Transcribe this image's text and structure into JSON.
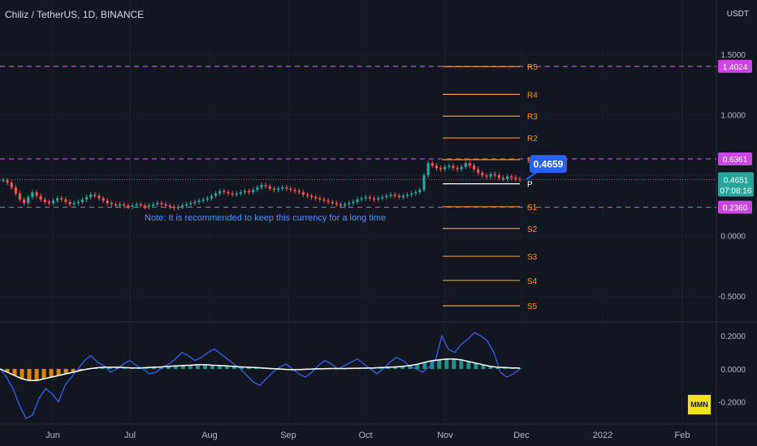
{
  "header": {
    "title": "Chiliz / TetherUS, 1D, BINANCE",
    "currency": "USDT"
  },
  "badge": "MMN",
  "colors": {
    "background": "#131722",
    "up": "#26a69a",
    "down": "#ef5350",
    "pivot": "#f7931a",
    "level": "#c946e0",
    "note": "#4f8ff7",
    "callout": "#2962ff",
    "oscillator": "#3465ff",
    "signal": "#ffffff"
  },
  "chart_data": [
    {
      "type": "candlestick",
      "title": "Chiliz / TetherUS, 1D, BINANCE",
      "x_ticks": [
        "Jun",
        "Jul",
        "Aug",
        "Sep",
        "Oct",
        "Nov",
        "Dec",
        "2022",
        "Feb"
      ],
      "y_ticks": [
        "1.5000",
        "1.0000",
        "0.5000",
        "0.0000",
        "-0.5000"
      ],
      "y_tick_values": [
        1.5,
        1.0,
        0.5,
        0.0,
        -0.5
      ],
      "ylim": [
        -0.7,
        1.75
      ],
      "last_price": "0.4651",
      "countdown": "07:08:16",
      "horizontal_levels": [
        {
          "value": 1.4024,
          "label": "1.4024"
        },
        {
          "value": 0.6361,
          "label": "0.6361"
        },
        {
          "value": 0.236,
          "label": "0.2360"
        }
      ],
      "pivots": [
        {
          "name": "R5",
          "value": 1.4
        },
        {
          "name": "R4",
          "value": 1.17
        },
        {
          "name": "R3",
          "value": 0.99
        },
        {
          "name": "R2",
          "value": 0.81
        },
        {
          "name": "R1",
          "value": 0.63
        },
        {
          "name": "P",
          "value": 0.43
        },
        {
          "name": "S1",
          "value": 0.24
        },
        {
          "name": "S2",
          "value": 0.06
        },
        {
          "name": "S3",
          "value": -0.17
        },
        {
          "name": "S4",
          "value": -0.37
        },
        {
          "name": "S5",
          "value": -0.58
        }
      ],
      "callout": {
        "label": "0.4659",
        "value": 0.4659
      },
      "annotation": "Note: It is recommended to keep this currency for a long time",
      "closes": [
        0.46,
        0.44,
        0.4,
        0.35,
        0.3,
        0.27,
        0.32,
        0.36,
        0.33,
        0.3,
        0.28,
        0.27,
        0.29,
        0.31,
        0.3,
        0.28,
        0.26,
        0.27,
        0.28,
        0.3,
        0.32,
        0.34,
        0.33,
        0.31,
        0.29,
        0.27,
        0.26,
        0.25,
        0.26,
        0.25,
        0.24,
        0.25,
        0.26,
        0.25,
        0.24,
        0.25,
        0.26,
        0.27,
        0.26,
        0.25,
        0.24,
        0.23,
        0.24,
        0.25,
        0.26,
        0.27,
        0.28,
        0.29,
        0.3,
        0.31,
        0.33,
        0.35,
        0.37,
        0.36,
        0.35,
        0.34,
        0.35,
        0.36,
        0.37,
        0.36,
        0.38,
        0.4,
        0.42,
        0.41,
        0.39,
        0.38,
        0.39,
        0.4,
        0.39,
        0.38,
        0.37,
        0.36,
        0.34,
        0.33,
        0.32,
        0.31,
        0.3,
        0.29,
        0.28,
        0.27,
        0.26,
        0.25,
        0.26,
        0.27,
        0.28,
        0.3,
        0.31,
        0.32,
        0.31,
        0.3,
        0.31,
        0.32,
        0.33,
        0.34,
        0.33,
        0.32,
        0.33,
        0.34,
        0.35,
        0.36,
        0.38,
        0.5,
        0.6,
        0.58,
        0.56,
        0.55,
        0.57,
        0.58,
        0.56,
        0.55,
        0.57,
        0.6,
        0.58,
        0.55,
        0.52,
        0.5,
        0.49,
        0.51,
        0.5,
        0.48,
        0.47,
        0.49,
        0.48,
        0.47,
        0.4651
      ]
    },
    {
      "type": "oscillator",
      "y_ticks": [
        "0.2000",
        "0.0000",
        "-0.2000"
      ],
      "y_tick_values": [
        0.2,
        0.0,
        -0.2
      ],
      "ylim": [
        -0.32,
        0.27
      ],
      "line": [
        0.0,
        -0.05,
        -0.12,
        -0.22,
        -0.3,
        -0.28,
        -0.18,
        -0.12,
        -0.15,
        -0.2,
        -0.1,
        -0.05,
        0.0,
        0.05,
        0.08,
        0.04,
        0.02,
        -0.02,
        0.0,
        0.03,
        0.05,
        0.02,
        0.0,
        -0.03,
        -0.02,
        0.01,
        0.03,
        0.06,
        0.1,
        0.08,
        0.05,
        0.07,
        0.1,
        0.12,
        0.09,
        0.06,
        0.03,
        0.0,
        -0.04,
        -0.08,
        -0.1,
        -0.06,
        -0.02,
        0.01,
        0.03,
        0.0,
        -0.03,
        -0.05,
        -0.02,
        0.02,
        0.05,
        0.03,
        0.0,
        0.02,
        0.04,
        0.06,
        0.03,
        0.0,
        -0.03,
        0.0,
        0.04,
        0.07,
        0.05,
        0.02,
        0.0,
        -0.02,
        0.01,
        0.05,
        0.2,
        0.12,
        0.1,
        0.15,
        0.18,
        0.22,
        0.2,
        0.17,
        0.1,
        -0.02,
        -0.05,
        -0.03,
        0.0
      ],
      "signal": [
        0.0,
        -0.02,
        -0.04,
        -0.06,
        -0.07,
        -0.07,
        -0.06,
        -0.05,
        -0.04,
        -0.03,
        -0.02,
        -0.01,
        0.0,
        0.005,
        0.01,
        0.01,
        0.01,
        0.008,
        0.006,
        0.005,
        0.008,
        0.01,
        0.012,
        0.015,
        0.018,
        0.02,
        0.022,
        0.025,
        0.025,
        0.022,
        0.02,
        0.018,
        0.015,
        0.012,
        0.01,
        0.008,
        0.005,
        0.002,
        0.0,
        -0.003,
        -0.005,
        -0.004,
        -0.002,
        0.0,
        0.001,
        0.002,
        0.002,
        0.002,
        0.003,
        0.004,
        0.005,
        0.006,
        0.008,
        0.01,
        0.012,
        0.015,
        0.02,
        0.028,
        0.04,
        0.05,
        0.055,
        0.06,
        0.06,
        0.055,
        0.045,
        0.035,
        0.025,
        0.015,
        0.01,
        0.008,
        0.006,
        0.005
      ]
    }
  ]
}
